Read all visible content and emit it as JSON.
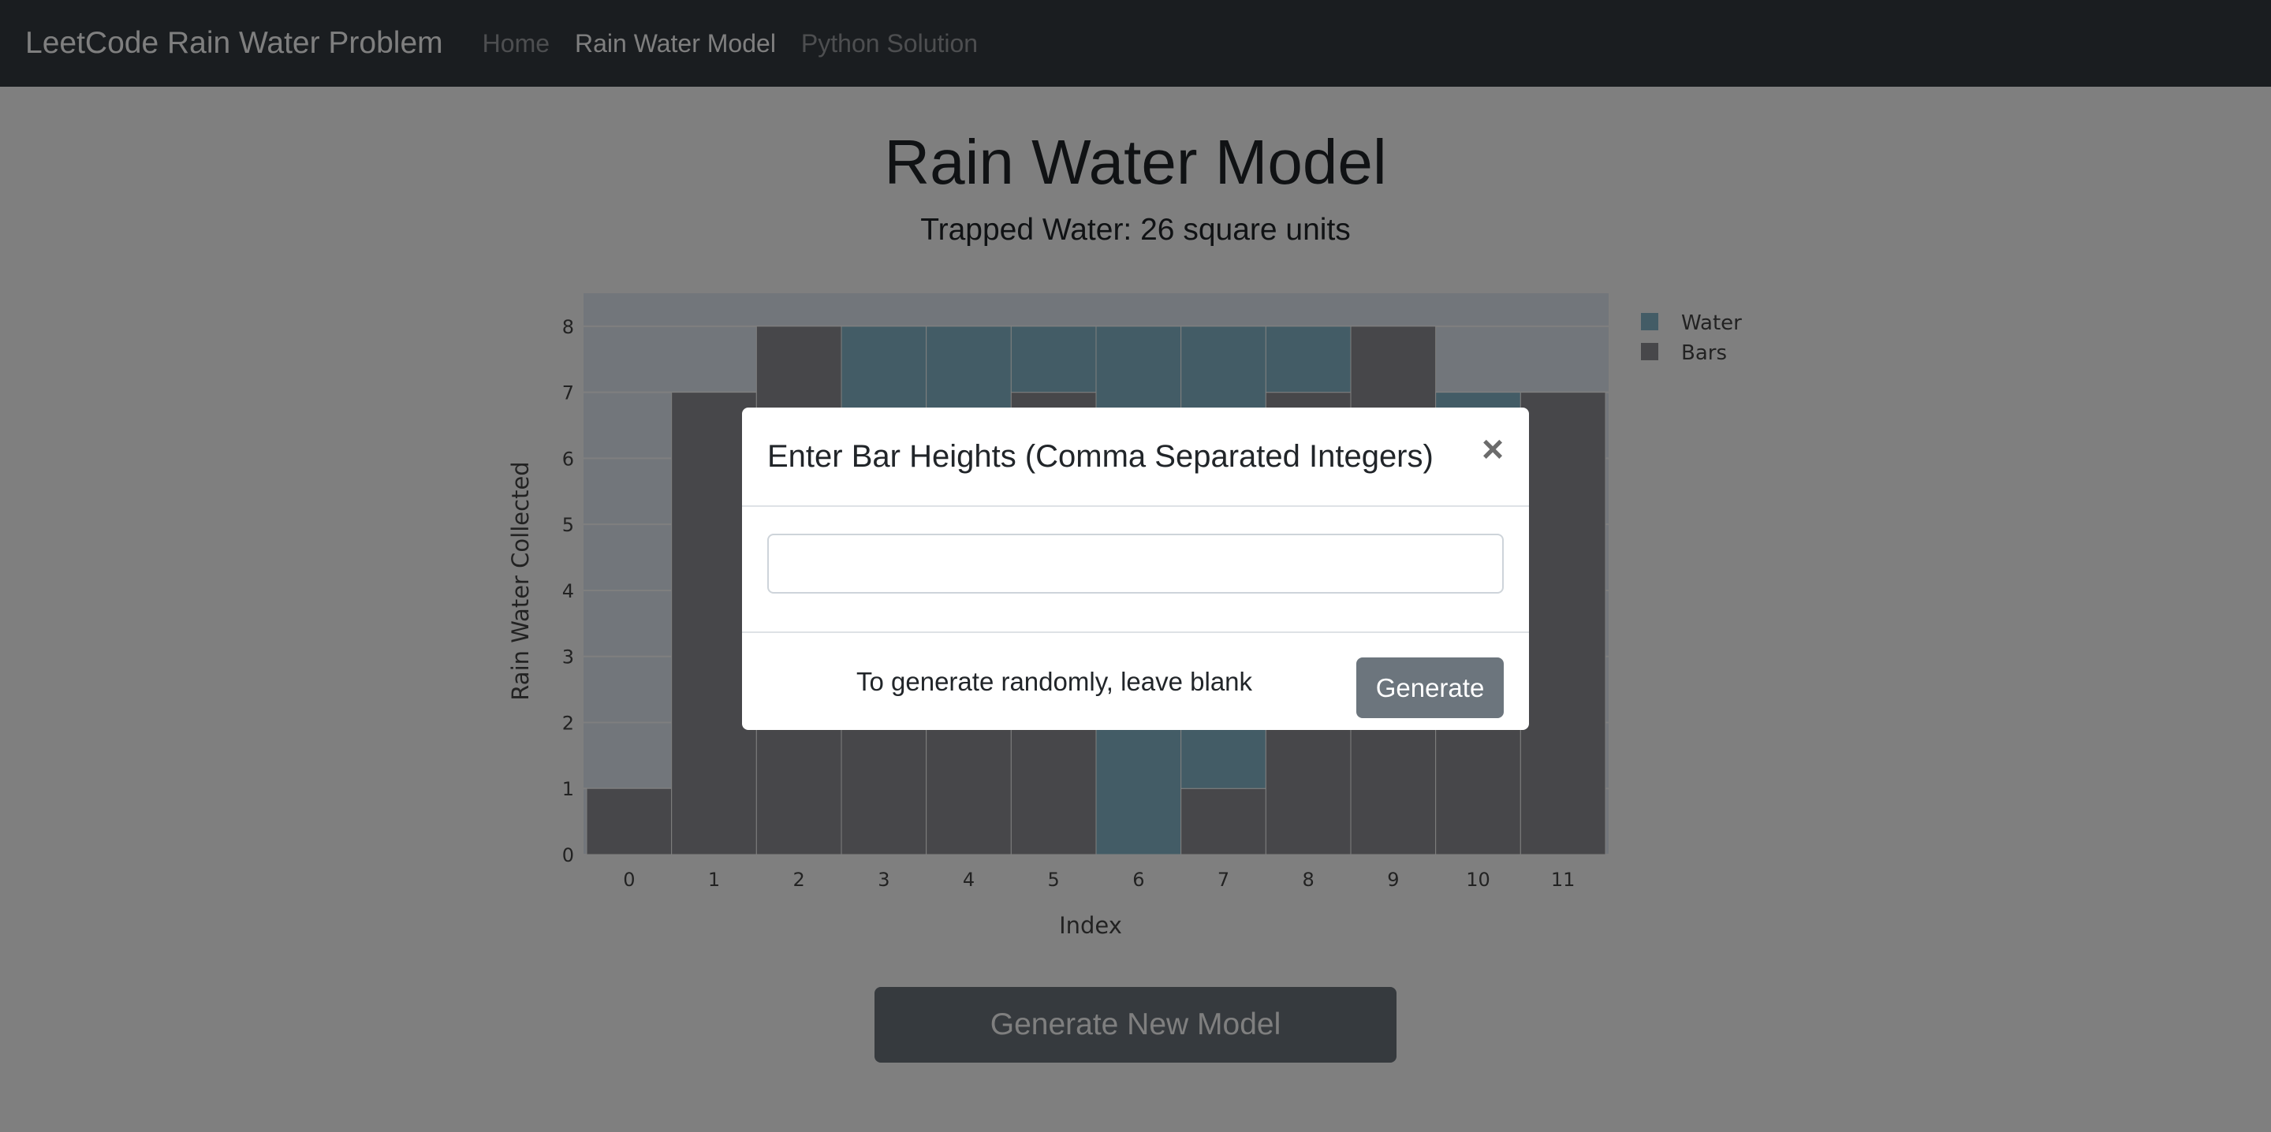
{
  "navbar": {
    "brand": "LeetCode Rain Water Problem",
    "links": [
      {
        "label": "Home",
        "active": false
      },
      {
        "label": "Rain Water Model",
        "active": true
      },
      {
        "label": "Python Solution",
        "active": false
      }
    ]
  },
  "main": {
    "title": "Rain Water Model",
    "subtitle": "Trapped Water: 26 square units",
    "generate_new_label": "Generate New Model"
  },
  "modal": {
    "title": "Enter Bar Heights (Comma Separated Integers)",
    "close_symbol": "×",
    "input_value": "",
    "input_placeholder": "",
    "footer_note": "To generate randomly, leave blank",
    "generate_label": "Generate"
  },
  "colors": {
    "navbar_bg": "#343a40",
    "water": "#86b9cc",
    "bars": "#8f8f94",
    "plot_bg": "#e5ecf6",
    "button_bg": "#6c757d"
  },
  "chart_data": {
    "type": "bar",
    "stacked": true,
    "xlabel": "Index",
    "ylabel": "Rain Water Collected",
    "categories": [
      "0",
      "1",
      "2",
      "3",
      "4",
      "5",
      "6",
      "7",
      "8",
      "9",
      "10",
      "11"
    ],
    "ylim": [
      0,
      8.5
    ],
    "yticks": [
      0,
      1,
      2,
      3,
      4,
      5,
      6,
      7,
      8
    ],
    "series": [
      {
        "name": "Bars",
        "color": "#8f8f94",
        "values": [
          1,
          7,
          8,
          4,
          2,
          7,
          0,
          1,
          7,
          8,
          6,
          7
        ]
      },
      {
        "name": "Water",
        "color": "#86b9cc",
        "values": [
          0,
          0,
          0,
          4,
          6,
          1,
          8,
          7,
          1,
          0,
          1,
          0
        ]
      }
    ],
    "legend": {
      "position": "top-right",
      "order": [
        "Water",
        "Bars"
      ]
    },
    "grid": true
  }
}
